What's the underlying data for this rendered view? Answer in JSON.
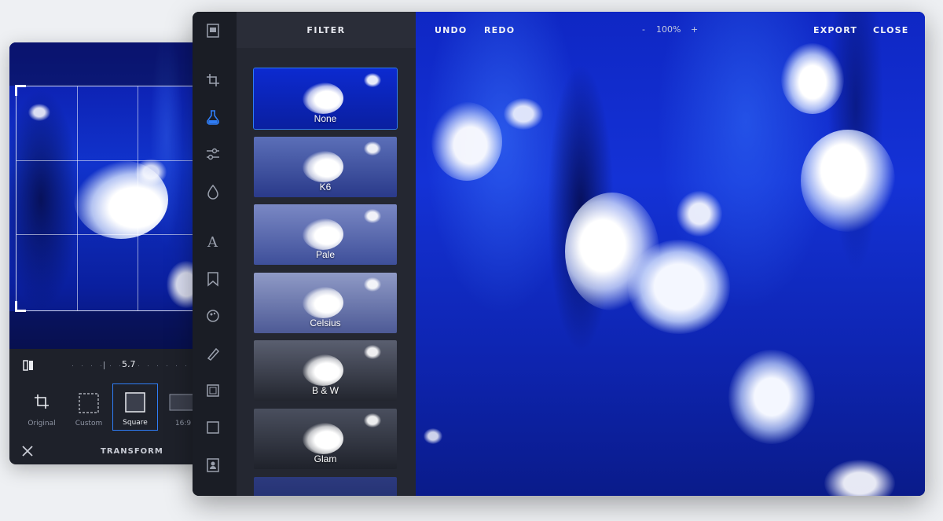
{
  "transform_panel": {
    "straighten_value": "5.7",
    "ratios": [
      {
        "label": "Original",
        "icon": "crop-icon"
      },
      {
        "label": "Custom",
        "icon": "dashed-square-icon"
      },
      {
        "label": "Square",
        "icon": "square-icon",
        "active": true
      },
      {
        "label": "16:9",
        "icon": "wide-rect-icon"
      }
    ],
    "footer_title": "TRANSFORM"
  },
  "editor": {
    "filter_panel": {
      "title": "FILTER",
      "filters": [
        {
          "label": "None",
          "active": true
        },
        {
          "label": "K6"
        },
        {
          "label": "Pale"
        },
        {
          "label": "Celsius"
        },
        {
          "label": "B & W"
        },
        {
          "label": "Glam"
        }
      ]
    },
    "top_bar": {
      "undo": "UNDO",
      "redo": "REDO",
      "zoom_minus": "-",
      "zoom_value": "100%",
      "zoom_plus": "+",
      "export": "EXPORT",
      "close": "CLOSE"
    },
    "tools": [
      "library-icon",
      "crop-icon",
      "filter-icon",
      "adjust-icon",
      "drop-icon",
      "text-icon",
      "sticker-icon",
      "brush-icon",
      "pen-icon",
      "frame-icon",
      "overlay-icon",
      "portrait-icon"
    ]
  },
  "colors": {
    "accent": "#2f7df6",
    "panel_bg": "#1e212a",
    "ocean_blue": "#1432d6"
  }
}
